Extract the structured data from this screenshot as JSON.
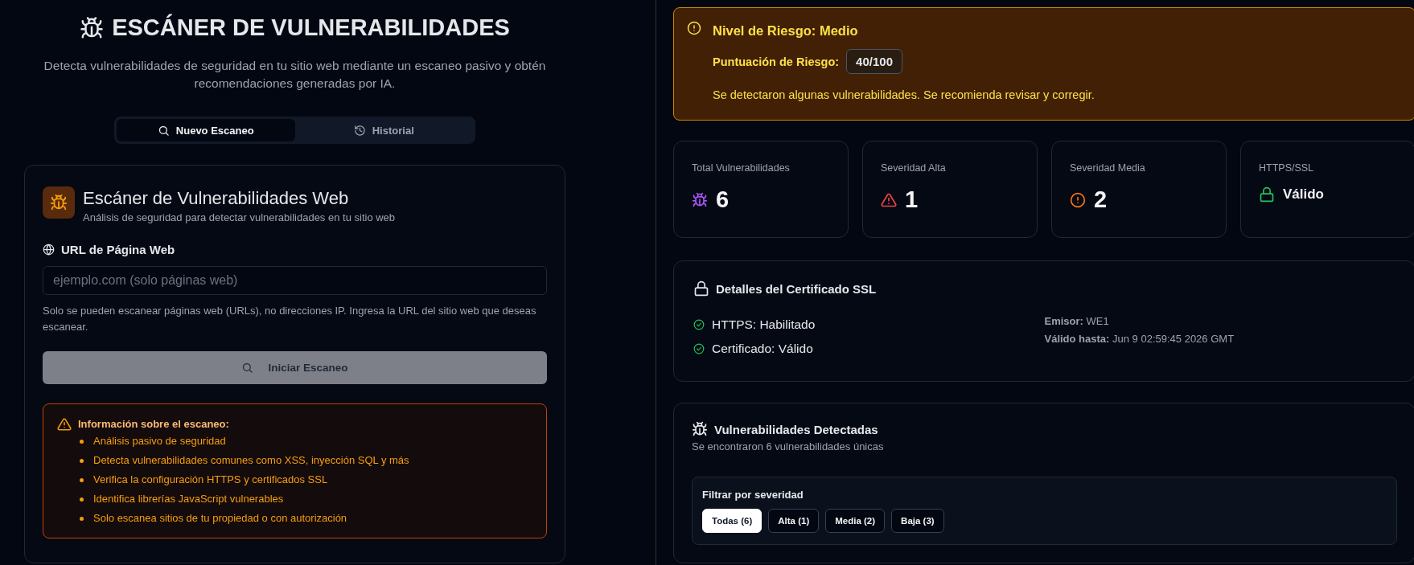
{
  "header": {
    "title": "ESCÁNER DE VULNERABILIDADES",
    "subtitle": "Detecta vulnerabilidades de seguridad en tu sitio web mediante un escaneo pasivo y obtén recomendaciones generadas por IA."
  },
  "tabs": [
    {
      "label": "Nuevo Escaneo",
      "kind": "search",
      "selected": true
    },
    {
      "label": "Historial",
      "kind": "history",
      "selected": false
    }
  ],
  "scanner_card": {
    "title": "Escáner de Vulnerabilidades Web",
    "subtitle": "Análisis de seguridad para detectar vulnerabilidades en tu sitio web",
    "url_label": "URL de Página Web",
    "url_field": {
      "placeholder": "ejemplo.com (solo páginas web)"
    },
    "help_text": "Solo se pueden escanear páginas web (URLs), no direcciones IP. Ingresa la URL del sitio web que deseas escanear.",
    "scan_button": {
      "label": "Iniciar Escaneo",
      "disabled": true
    },
    "info": {
      "title": "Información sobre el escaneo:",
      "items": [
        "Análisis pasivo de seguridad",
        "Detecta vulnerabilidades comunes como XSS, inyección SQL y más",
        "Verifica la configuración HTTPS y certificados SSL",
        "Identifica librerías JavaScript vulnerables",
        "Solo escanea sitios de tu propiedad o con autorización"
      ]
    }
  },
  "risk": {
    "title": "Nivel de Riesgo: Medio",
    "score_label": "Puntuación de Riesgo:",
    "score": "40/100",
    "message": "Se detectaron algunas vulnerabilidades. Se recomienda revisar y corregir."
  },
  "stats": [
    {
      "label": "Total Vulnerabilidades",
      "value": "6",
      "kind": "bug"
    },
    {
      "label": "Severidad Alta",
      "value": "1",
      "kind": "alert"
    },
    {
      "label": "Severidad Media",
      "value": "2",
      "kind": "warning"
    },
    {
      "label": "HTTPS/SSL",
      "value": "Válido",
      "kind": "lock"
    }
  ],
  "ssl": {
    "title": "Detalles del Certificado SSL",
    "checks": [
      {
        "label": "HTTPS: Habilitado",
        "ok": true
      },
      {
        "label": "Certificado: Válido",
        "ok": true
      }
    ],
    "details": [
      {
        "key": "Emisor:",
        "value": "WE1"
      },
      {
        "key": "Válido hasta:",
        "value": "Jun 9 02:59:45 2026 GMT"
      }
    ]
  },
  "vulnerabilities": {
    "title": "Vulnerabilidades Detectadas",
    "subtitle": "Se encontraron 6 vulnerabilidades únicas",
    "filter": {
      "title": "Filtrar por severidad",
      "options": [
        {
          "label": "Todas (6)",
          "selected": true
        },
        {
          "label": "Alta (1)",
          "selected": false
        },
        {
          "label": "Media (2)",
          "selected": false
        },
        {
          "label": "Baja (3)",
          "selected": false
        }
      ]
    }
  }
}
